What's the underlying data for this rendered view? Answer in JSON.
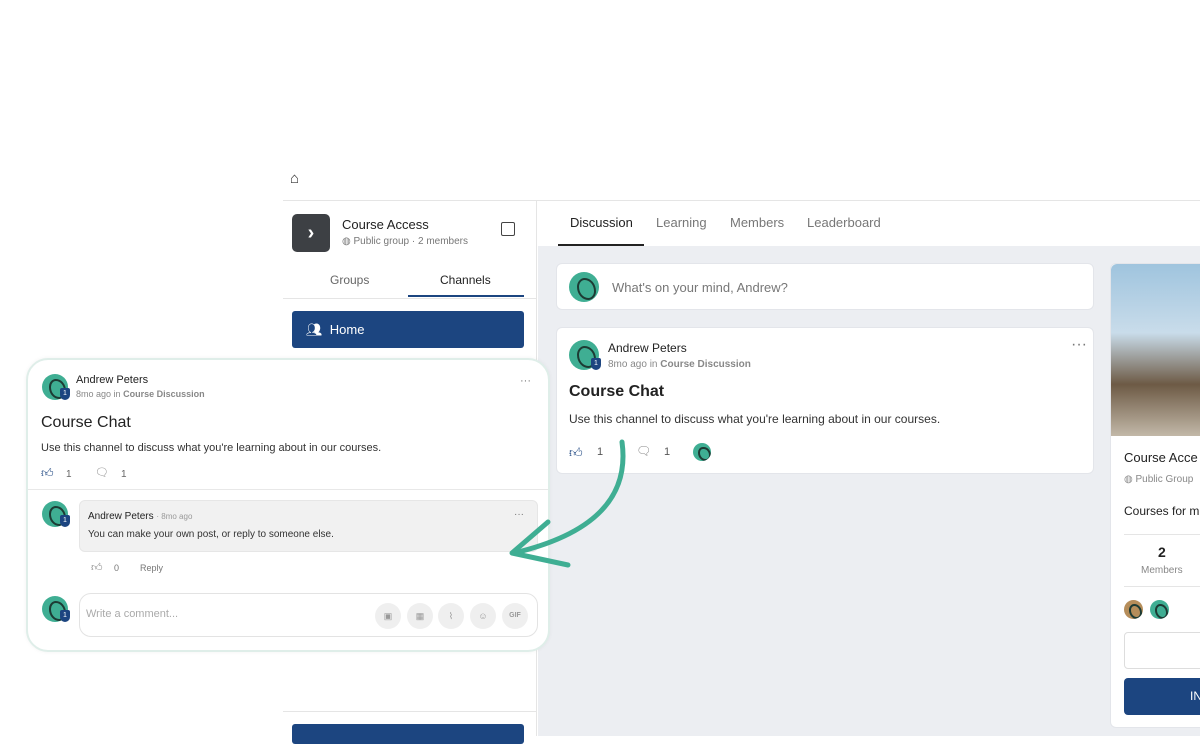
{
  "group": {
    "name": "Course Access",
    "privacy": "Public group",
    "members": "2 members"
  },
  "sidebar_tabs": [
    "Groups",
    "Channels"
  ],
  "sidebar_items": [
    {
      "label": "Home",
      "icon": "users-icon"
    }
  ],
  "main_tabs": [
    "Discussion",
    "Learning",
    "Members",
    "Leaderboard"
  ],
  "composer": {
    "placeholder": "What's on your mind, Andrew?"
  },
  "post": {
    "author": "Andrew Peters",
    "time": "8mo ago",
    "in": "in",
    "channel": "Course Discussion",
    "title": "Course Chat",
    "body": "Use this channel to discuss what you're learning about in our courses.",
    "likes": "1",
    "comments": "1"
  },
  "comment": {
    "author": "Andrew Peters",
    "time": "· 8mo ago",
    "body": "You can make your own post, or reply to someone else.",
    "likes": "0",
    "reply": "Reply"
  },
  "comment_input": {
    "placeholder": "Write a comment...",
    "gif": "GIF"
  },
  "right_card": {
    "name": "Course Acce",
    "privacy": "Public Group",
    "desc": "Courses for m",
    "members_count": "2",
    "members_label": "Members",
    "button": "IN"
  },
  "colors": {
    "primary": "#1c4580",
    "accent": "#3fae93"
  }
}
